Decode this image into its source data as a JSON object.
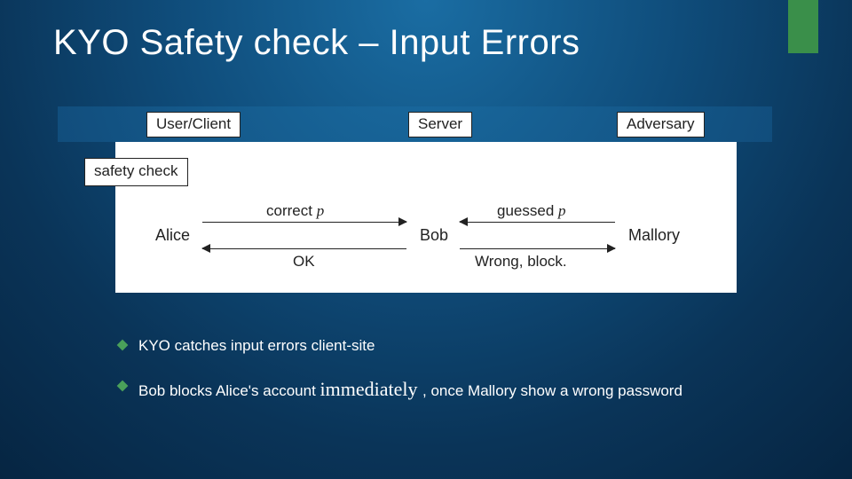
{
  "title": {
    "kyo": "KYO",
    "rest": " Safety check – Input Errors"
  },
  "diagram": {
    "roles": {
      "user": "User/Client",
      "server": "Server",
      "adversary": "Adversary"
    },
    "safety_check": "safety check",
    "actors": {
      "alice": "Alice",
      "bob": "Bob",
      "mallory": "Mallory"
    },
    "labels": {
      "correct_prefix": "correct ",
      "correct_var": "p",
      "ok": "OK",
      "guessed_prefix": "guessed ",
      "guessed_var": "p",
      "wrong": "Wrong, block."
    }
  },
  "bullets": {
    "b1": "KYO catches input errors client-site",
    "b2_pre": "Bob blocks Alice's account ",
    "b2_big": "immediately ",
    "b2_post": ", once Mallory show a wrong password"
  }
}
